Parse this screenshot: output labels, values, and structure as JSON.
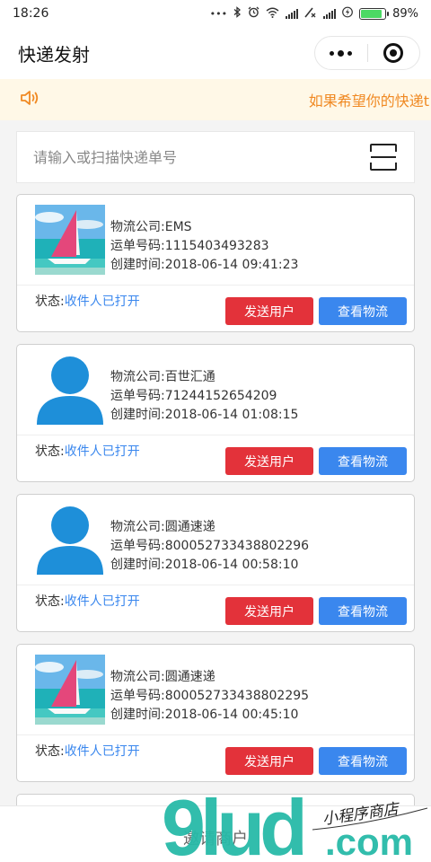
{
  "status_bar": {
    "time": "18:26",
    "battery_percent": "89%",
    "battery_level": 0.89,
    "icons": [
      "dots-icon",
      "bluetooth-icon",
      "alarm-icon",
      "wifi-icon",
      "signal-icon",
      "signal-x-icon",
      "signal-icon",
      "charging-icon",
      "battery-icon"
    ]
  },
  "nav": {
    "title": "快递发射",
    "menu_icon": "more-dots-icon",
    "close_icon": "target-icon"
  },
  "notice": {
    "icon": "speaker-icon",
    "text": "如果希望你的快递t"
  },
  "search": {
    "placeholder": "请输入或扫描快递单号",
    "scan_icon": "scan-icon"
  },
  "labels": {
    "company": "物流公司:",
    "tracking": "运单号码:",
    "created": "创建时间:",
    "status": "状态:",
    "send_button": "发送用户",
    "view_button": "查看物流"
  },
  "cards": [
    {
      "avatar": "sailboat-photo",
      "company": "EMS",
      "tracking": "1115403493283",
      "created": "2018-06-14 09:41:23",
      "status": "收件人已打开"
    },
    {
      "avatar": "person-silhouette",
      "company": "百世汇通",
      "tracking": "71244152654209",
      "created": "2018-06-14 01:08:15",
      "status": "收件人已打开"
    },
    {
      "avatar": "person-silhouette",
      "company": "圆通速递",
      "tracking": "800052733438802296",
      "created": "2018-06-14 00:58:10",
      "status": "收件人已打开"
    },
    {
      "avatar": "sailboat-photo",
      "company": "圆通速递",
      "tracking": "800052733438802295",
      "created": "2018-06-14 00:45:10",
      "status": "收件人已打开"
    }
  ],
  "bottom": {
    "invite": "邀请商户"
  },
  "watermark": {
    "brand": "9lud.com",
    "tagline": "小程序商店"
  },
  "colors": {
    "send": "#e3323a",
    "view": "#3a87ee",
    "notice_text": "#f08a24",
    "notice_bg": "#fff8e7",
    "status_value": "#3a87ee",
    "watermark_teal": "#27b9a8"
  }
}
